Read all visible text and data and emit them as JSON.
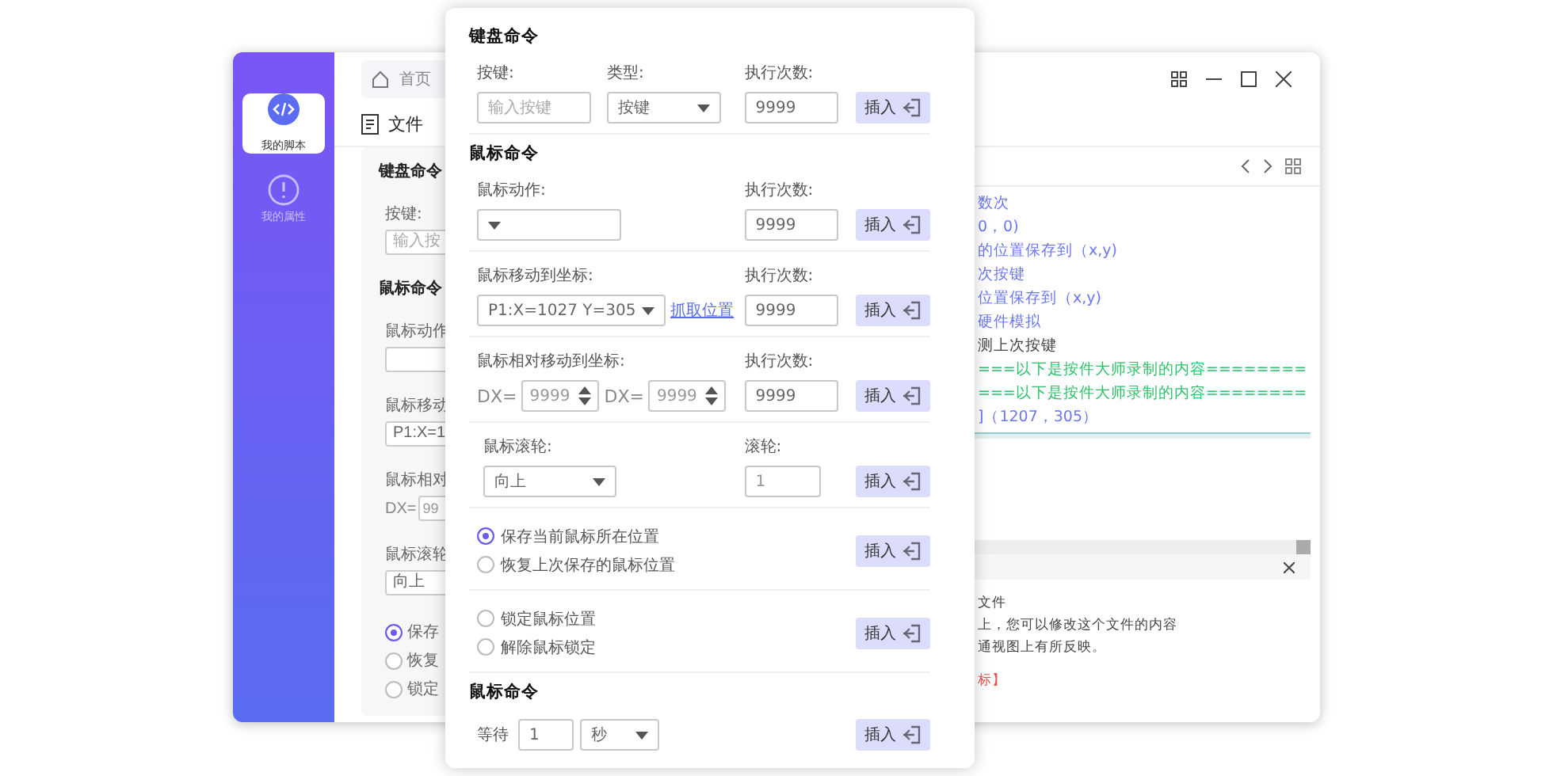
{
  "sidebar": {
    "items": [
      {
        "label": "我的脚本",
        "selected": true
      },
      {
        "label": "我的属性",
        "selected": false
      }
    ]
  },
  "tab": {
    "label": "首页"
  },
  "toolbar": [
    {
      "label": "文件"
    }
  ],
  "left_panel": [
    {
      "kind": "title",
      "text": "键盘命令"
    },
    {
      "kind": "label",
      "text": "按键:"
    },
    {
      "kind": "field",
      "placeholder": "输入按"
    },
    {
      "kind": "title",
      "text": "鼠标命令"
    },
    {
      "kind": "label",
      "text": "鼠标动作"
    },
    {
      "kind": "field"
    },
    {
      "kind": "label",
      "text": "鼠标移动"
    },
    {
      "kind": "field",
      "text": "P1:X=1"
    },
    {
      "kind": "label",
      "text": "鼠标相对"
    },
    {
      "kind": "prefixed",
      "prefix": "DX=",
      "text": "99"
    },
    {
      "kind": "label",
      "text": "鼠标滚轮"
    },
    {
      "kind": "field",
      "text": "向上"
    },
    {
      "kind": "radio",
      "text": "保存",
      "selected": true
    },
    {
      "kind": "radio",
      "text": "恢复",
      "selected": false
    },
    {
      "kind": "radio",
      "text": "锁定",
      "selected": false
    }
  ],
  "script_lines": [
    {
      "kind": "call",
      "text": "数次"
    },
    {
      "kind": "call",
      "text": "0，0)"
    },
    {
      "kind": "call",
      "text": "的位置保存到（x,y)"
    },
    {
      "kind": "call",
      "text": "次按键"
    },
    {
      "kind": "call",
      "text": "位置保存到（x,y)"
    },
    {
      "kind": "call",
      "text": "硬件模拟"
    },
    {
      "kind": "plain",
      "text": "测上次按键"
    },
    {
      "kind": "marker",
      "text": "===以下是按件大师录制的内容========"
    },
    {
      "kind": "marker",
      "text": "===以下是按件大师录制的内容========"
    },
    {
      "kind": "call",
      "text": "]（1207，305）"
    }
  ],
  "output_lines": [
    {
      "kind": "plain",
      "text": "文件"
    },
    {
      "kind": "plain",
      "text": "上，您可以修改这个文件的内容"
    },
    {
      "kind": "plain",
      "text": "通视图上有所反映。"
    },
    {
      "kind": "error",
      "text": "标】"
    }
  ],
  "dialog": {
    "sections": [
      {
        "title": "键盘命令",
        "rows": [
          {
            "kind": "key",
            "key_label": "按键:",
            "key_placeholder": "输入按键",
            "type_label": "类型:",
            "type_value": "按键",
            "count_label": "执行次数:",
            "count_value": "9999",
            "button": "插入"
          }
        ]
      },
      {
        "title": "鼠标命令",
        "rows": [
          {
            "kind": "action",
            "label": "鼠标动作:",
            "count_label": "执行次数:",
            "count_value": "9999",
            "button": "插入"
          },
          {
            "kind": "move",
            "label": "鼠标移动到坐标:",
            "value": "P1:X=1027 Y=305",
            "link": "抓取位置",
            "count_label": "执行次数:",
            "count_value": "9999",
            "button": "插入"
          },
          {
            "kind": "relative",
            "label": "鼠标相对移动到坐标:",
            "fields": [
              {
                "prefix": "DX=",
                "value": "9999"
              },
              {
                "prefix": "DX=",
                "value": "9999"
              }
            ],
            "count_label": "执行次数:",
            "count_value": "9999",
            "button": "插入"
          },
          {
            "kind": "wheel",
            "label": "鼠标滚轮:",
            "value": "向上",
            "count_label": "滚轮:",
            "count_value": "1",
            "button": "插入"
          },
          {
            "kind": "radios",
            "options": [
              {
                "label": "保存当前鼠标所在位置",
                "selected": true
              },
              {
                "label": "恢复上次保存的鼠标位置",
                "selected": false
              }
            ],
            "button": "插入"
          },
          {
            "kind": "radios",
            "options": [
              {
                "label": "锁定鼠标位置",
                "selected": false
              },
              {
                "label": "解除鼠标锁定",
                "selected": false
              }
            ],
            "button": "插入"
          }
        ]
      },
      {
        "title": "鼠标命令",
        "rows": [
          {
            "kind": "wait",
            "label": "等待",
            "value": "1",
            "unit": "秒",
            "button": "插入"
          }
        ]
      }
    ]
  }
}
